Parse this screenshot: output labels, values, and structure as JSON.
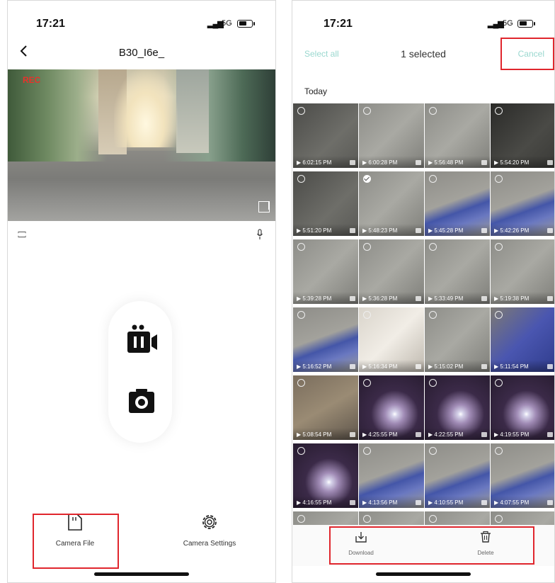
{
  "left": {
    "status": {
      "time": "17:21",
      "network": "5G"
    },
    "title": "B30_I6e_",
    "back_icon": "chevron-left-icon",
    "rec_label": "REC",
    "bottom": {
      "file_label": "Camera File",
      "settings_label": "Camera Settings"
    },
    "icons": [
      "rotate-icon",
      "microphone-icon",
      "fullscreen-icon",
      "pause-video-icon",
      "camera-icon",
      "sd-card-icon",
      "gear-icon"
    ],
    "highlight_color": "#e0262d"
  },
  "right": {
    "status": {
      "time": "17:21",
      "network": "5G"
    },
    "select_all": "Select all",
    "selected_count": "1 selected",
    "cancel": "Cancel",
    "section": "Today",
    "thumbnails": [
      {
        "time": "6:02:15 PM",
        "selected": false,
        "tone": "dark-gray"
      },
      {
        "time": "6:00:28 PM",
        "selected": false,
        "tone": "gray"
      },
      {
        "time": "5:56:48 PM",
        "selected": false,
        "tone": "gray"
      },
      {
        "time": "5:54:20 PM",
        "selected": false,
        "tone": "dark"
      },
      {
        "time": "5:51:20 PM",
        "selected": false,
        "tone": "dark-gray"
      },
      {
        "time": "5:48:23 PM",
        "selected": true,
        "tone": "gray"
      },
      {
        "time": "5:45:28 PM",
        "selected": false,
        "tone": "blue"
      },
      {
        "time": "5:42:26 PM",
        "selected": false,
        "tone": "blue"
      },
      {
        "time": "5:39:28 PM",
        "selected": false,
        "tone": "gray"
      },
      {
        "time": "5:36:28 PM",
        "selected": false,
        "tone": "gray"
      },
      {
        "time": "5:33:49 PM",
        "selected": false,
        "tone": "gray"
      },
      {
        "time": "5:19:38 PM",
        "selected": false,
        "tone": "gray"
      },
      {
        "time": "5:16:52 PM",
        "selected": false,
        "tone": "blue"
      },
      {
        "time": "5:16:34 PM",
        "selected": false,
        "tone": "light"
      },
      {
        "time": "5:15:02 PM",
        "selected": false,
        "tone": "gray"
      },
      {
        "time": "5:11:54 PM",
        "selected": false,
        "tone": "device"
      },
      {
        "time": "5:08:54 PM",
        "selected": false,
        "tone": "warm"
      },
      {
        "time": "4:25:55 PM",
        "selected": false,
        "tone": "purple"
      },
      {
        "time": "4:22:55 PM",
        "selected": false,
        "tone": "purple"
      },
      {
        "time": "4:19:55 PM",
        "selected": false,
        "tone": "purple"
      },
      {
        "time": "4:16:55 PM",
        "selected": false,
        "tone": "purple"
      },
      {
        "time": "4:13:56 PM",
        "selected": false,
        "tone": "blue"
      },
      {
        "time": "4:10:55 PM",
        "selected": false,
        "tone": "blue"
      },
      {
        "time": "4:07:55 PM",
        "selected": false,
        "tone": "blue"
      },
      {
        "time": "",
        "selected": false,
        "tone": "gray"
      },
      {
        "time": "",
        "selected": false,
        "tone": "gray"
      },
      {
        "time": "",
        "selected": false,
        "tone": "gray"
      },
      {
        "time": "",
        "selected": false,
        "tone": "gray"
      }
    ],
    "actions": {
      "download_label": "Download",
      "delete_label": "Delete"
    },
    "icons": [
      "download-icon",
      "trash-icon",
      "play-icon"
    ],
    "accent_color": "#9ad8cf",
    "highlight_color": "#e0262d"
  }
}
